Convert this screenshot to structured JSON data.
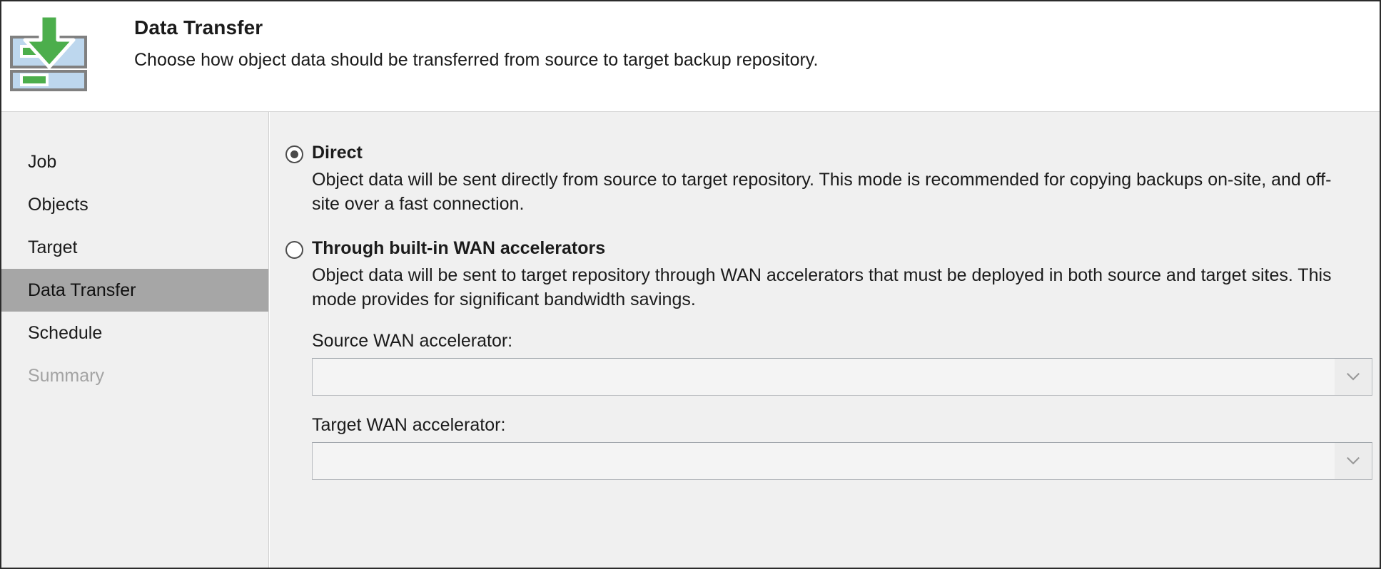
{
  "header": {
    "icon": "data-transfer-repository-icon",
    "title": "Data Transfer",
    "subtitle": "Choose how object data should be transferred from source to target backup repository."
  },
  "sidebar": {
    "items": [
      {
        "label": "Job",
        "state": "normal"
      },
      {
        "label": "Objects",
        "state": "normal"
      },
      {
        "label": "Target",
        "state": "normal"
      },
      {
        "label": "Data Transfer",
        "state": "selected"
      },
      {
        "label": "Schedule",
        "state": "normal"
      },
      {
        "label": "Summary",
        "state": "disabled"
      }
    ]
  },
  "main": {
    "options": [
      {
        "label": "Direct",
        "checked": true,
        "description": "Object data will be sent directly from source to target repository. This mode is recommended for copying backups on-site, and off-site over a fast connection."
      },
      {
        "label": "Through built-in WAN accelerators",
        "checked": false,
        "description": "Object data will be sent to target repository through WAN accelerators that must be deployed in both source and target sites. This mode provides for significant bandwidth savings."
      }
    ],
    "fields": [
      {
        "label": "Source WAN accelerator:",
        "value": "",
        "arrow_icon": "chevron-down-icon"
      },
      {
        "label": "Target WAN accelerator:",
        "value": "",
        "arrow_icon": "chevron-down-icon"
      }
    ]
  },
  "colors": {
    "selected_nav": "#a6a6a6",
    "panel_bg": "#f0f0f0",
    "icon_green": "#4cae4c",
    "icon_blue": "#bdd7ee",
    "text": "#1b1b1b",
    "disabled_text": "#a3a3a3"
  }
}
